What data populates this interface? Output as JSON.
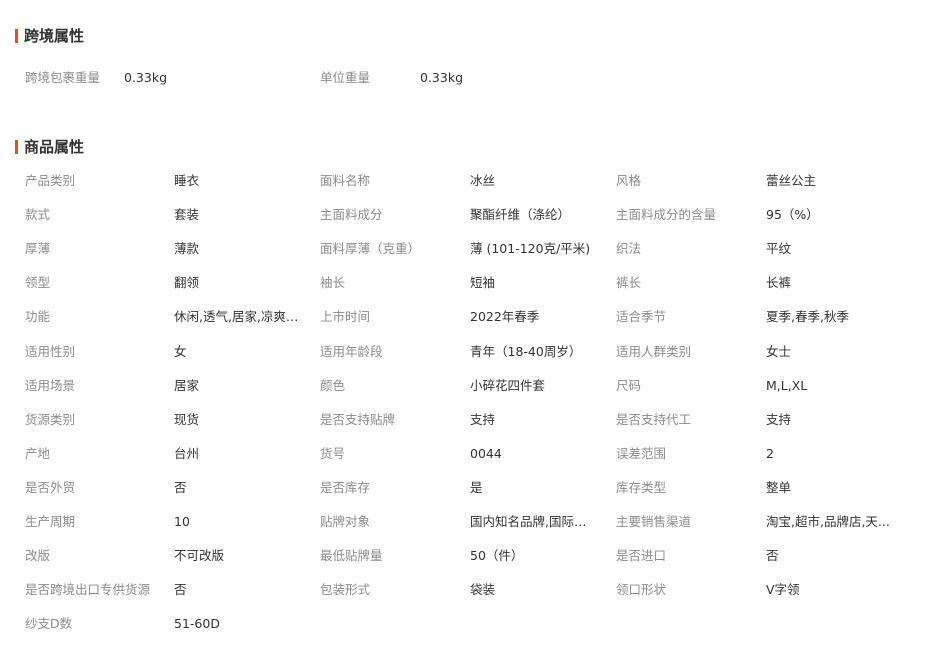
{
  "cross_border": {
    "title": "跨境属性",
    "items": [
      {
        "label": "跨境包裹重量",
        "value": "0.33kg"
      },
      {
        "label": "单位重量",
        "value": "0.33kg"
      }
    ]
  },
  "product": {
    "title": "商品属性",
    "rows": [
      [
        {
          "label": "产品类别",
          "value": "睡衣"
        },
        {
          "label": "面料名称",
          "value": "冰丝"
        },
        {
          "label": "风格",
          "value": "蕾丝公主"
        }
      ],
      [
        {
          "label": "款式",
          "value": "套装"
        },
        {
          "label": "主面料成分",
          "value": "聚酯纤维（涤纶）"
        },
        {
          "label": "主面料成分的含量",
          "value": "95（%）"
        }
      ],
      [
        {
          "label": "厚薄",
          "value": "薄款"
        },
        {
          "label": "面料厚薄（克重）",
          "value": "薄 (101-120克/平米)"
        },
        {
          "label": "织法",
          "value": "平纹"
        }
      ],
      [
        {
          "label": "领型",
          "value": "翻领"
        },
        {
          "label": "袖长",
          "value": "短袖"
        },
        {
          "label": "裤长",
          "value": "长裤"
        }
      ],
      [
        {
          "label": "功能",
          "value": "休闲,透气,居家,凉爽,..."
        },
        {
          "label": "上市时间",
          "value": "2022年春季"
        },
        {
          "label": "适合季节",
          "value": "夏季,春季,秋季"
        }
      ],
      [
        {
          "label": "适用性别",
          "value": "女"
        },
        {
          "label": "适用年龄段",
          "value": "青年（18-40周岁）"
        },
        {
          "label": "适用人群类别",
          "value": "女士"
        }
      ],
      [
        {
          "label": "适用场景",
          "value": "居家"
        },
        {
          "label": "颜色",
          "value": "小碎花四件套"
        },
        {
          "label": "尺码",
          "value": "M,L,XL"
        }
      ],
      [
        {
          "label": "货源类别",
          "value": "现货"
        },
        {
          "label": "是否支持贴牌",
          "value": "支持"
        },
        {
          "label": "是否支持代工",
          "value": "支持"
        }
      ],
      [
        {
          "label": "产地",
          "value": "台州"
        },
        {
          "label": "货号",
          "value": "0044"
        },
        {
          "label": "误差范围",
          "value": "2"
        }
      ],
      [
        {
          "label": "是否外贸",
          "value": "否"
        },
        {
          "label": "是否库存",
          "value": "是"
        },
        {
          "label": "库存类型",
          "value": "整单"
        }
      ],
      [
        {
          "label": "生产周期",
          "value": "10"
        },
        {
          "label": "贴牌对象",
          "value": "国内知名品牌,国际知..."
        },
        {
          "label": "主要销售渠道",
          "value": "淘宝,超市,品牌店,天..."
        }
      ],
      [
        {
          "label": "改版",
          "value": "不可改版"
        },
        {
          "label": "最低贴牌量",
          "value": "50（件）"
        },
        {
          "label": "是否进口",
          "value": "否"
        }
      ],
      [
        {
          "label": "是否跨境出口专供货源",
          "value": "否"
        },
        {
          "label": "包装形式",
          "value": "袋装"
        },
        {
          "label": "领口形状",
          "value": "V字领"
        }
      ],
      [
        {
          "label": "纱支D数",
          "value": "51-60D"
        }
      ]
    ]
  },
  "colors": {
    "accent": "#e4540e",
    "label": "#8c8c8c",
    "value": "#333333"
  }
}
